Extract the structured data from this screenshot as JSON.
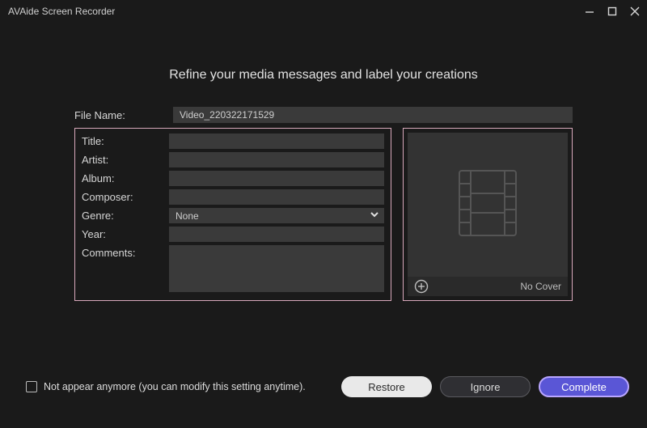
{
  "app": {
    "title": "AVAide Screen Recorder"
  },
  "heading": "Refine your media messages and label your creations",
  "labels": {
    "file_name": "File Name:",
    "title": "Title:",
    "artist": "Artist:",
    "album": "Album:",
    "composer": "Composer:",
    "genre": "Genre:",
    "year": "Year:",
    "comments": "Comments:"
  },
  "fields": {
    "file_name": "Video_220322171529",
    "title": "",
    "artist": "",
    "album": "",
    "composer": "",
    "genre": "None",
    "year": "",
    "comments": ""
  },
  "cover": {
    "no_cover": "No Cover"
  },
  "footer": {
    "checkbox_label": "Not appear anymore (you can modify this setting anytime).",
    "restore": "Restore",
    "ignore": "Ignore",
    "complete": "Complete"
  }
}
